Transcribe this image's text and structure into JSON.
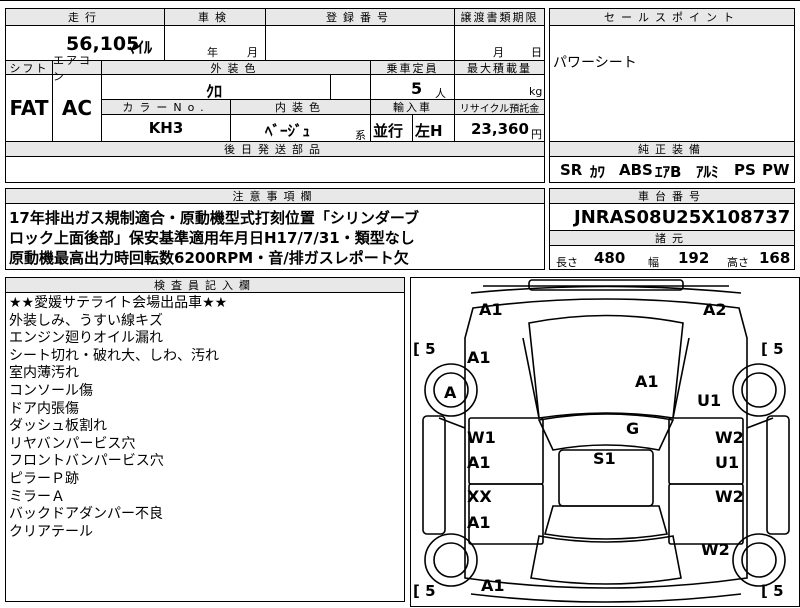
{
  "header": {
    "mileage_label": "走行",
    "inspection_label": "車検",
    "plate_label": "登録番号",
    "transfer_label": "譲渡書類期限",
    "sales_point_label": "セールスポイント"
  },
  "mileage": {
    "value": "56,105",
    "unit": "ﾏｲﾙ"
  },
  "inspection": {
    "year_unit": "年",
    "month_unit": "月"
  },
  "transfer": {
    "month_unit": "月",
    "day_unit": "日"
  },
  "sales_point": {
    "text": "パワーシート"
  },
  "row2": {
    "shift_label": "シフト",
    "ac_label": "エアコン",
    "exterior_color_label": "外装色",
    "capacity_label": "乗車定員",
    "max_load_label": "最大積載量",
    "shift_value": "FAT",
    "ac_value": "AC",
    "exterior_color_value": "ｸﾛ",
    "capacity_value": "5",
    "capacity_unit": "人",
    "max_load_unit": "kg",
    "color_no_label": "カラーNo.",
    "interior_color_label": "内装色",
    "import_label": "輸入車",
    "recycle_label": "リサイクル預託金",
    "color_no_value": "KH3",
    "interior_color_value": "ﾍﾞｰｼﾞｭ",
    "interior_suffix": "系",
    "import_value_1": "並行",
    "import_value_2": "左H",
    "recycle_value": "23,360",
    "recycle_unit": "円"
  },
  "later_parts": {
    "label": "後日発送部品"
  },
  "standard_equipment": {
    "label": "純正装備",
    "items": [
      "SR",
      "ｶﾜ",
      "ABS",
      "ｴｱB",
      "ｱﾙﾐ",
      "PS",
      "PW"
    ]
  },
  "caution": {
    "label": "注意事項欄",
    "lines": [
      "17年排出ガス規制適合・原動機型式打刻位置「シリンダーブ",
      "ロック上面後部」保安基準適用年月日H17/7/31・類型なし",
      "原動機最高出力時回転数6200RPM・音/排ガスレポート欠"
    ]
  },
  "chassis": {
    "label": "車台番号",
    "value": "JNRAS08U25X108737"
  },
  "dimensions": {
    "label": "諸元",
    "length_label": "長さ",
    "length_value": "480",
    "width_label": "幅",
    "width_value": "192",
    "height_label": "高さ",
    "height_value": "168"
  },
  "inspector": {
    "label": "検査員記入欄",
    "lines": [
      "★★愛媛サテライト会場出品車★★",
      "外装しみ、うすい線キズ",
      "エンジン廻りオイル漏れ",
      "シート切れ・破れ大、しわ、汚れ",
      "室内薄汚れ",
      "コンソール傷",
      "ドア内張傷",
      "ダッシュ板割れ",
      "リヤバンパービス穴",
      "フロントバンパービス穴",
      "ピラーＰ跡",
      "ミラーＡ",
      "バックドアダンパー不良",
      "クリアテール"
    ]
  },
  "diagram": {
    "marks": {
      "front_left_bumper": "A1",
      "front_right_bumper": "A2",
      "front_left_fender": "A1",
      "front_left_wheel": "A",
      "hood": "A1",
      "front_right_fender": "U1",
      "windshield": "G",
      "roof": "S1",
      "front_left_door_1": "W1",
      "front_left_door_2": "A1",
      "front_right_door_1": "W2",
      "front_right_door_2": "U1",
      "rear_left_door_1": "XX",
      "rear_left_door_2": "A1",
      "rear_right_door": "W2",
      "rear_right_quarter": "W2",
      "rear_left_bumper": "A1"
    },
    "tire_left_top": "5",
    "tire_right_top": "5",
    "tire_left_bottom": "5",
    "tire_right_bottom": "5"
  }
}
